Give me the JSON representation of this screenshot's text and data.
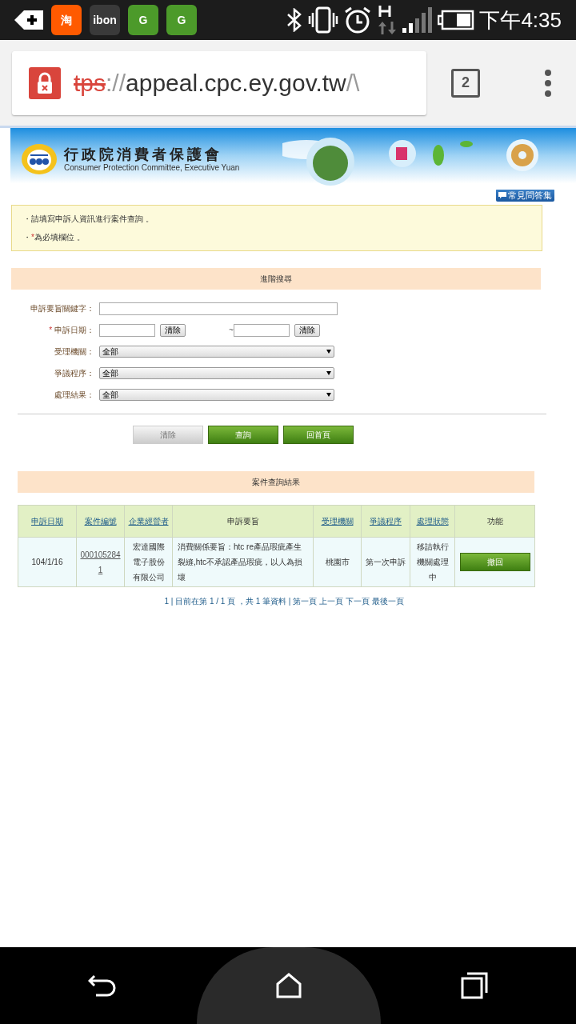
{
  "status_bar": {
    "apps": [
      {
        "label": "淘",
        "color": "#ff5a00"
      },
      {
        "label": "ibon",
        "color": "#3a3a3a"
      },
      {
        "label": "G",
        "color": "#4c9a2a"
      },
      {
        "label": "G",
        "color": "#4c9a2a"
      }
    ],
    "time": "下午4:35"
  },
  "browser": {
    "url": {
      "scheme": "tps",
      "separator": "://",
      "host": "appeal.cpc.ey.gov.tw",
      "rest": "/\\"
    },
    "tab_count": "2"
  },
  "banner": {
    "title": "行政院消費者保護會",
    "subtitle": "Consumer Protection Committee, Executive Yuan",
    "faq_button": "常見問答集"
  },
  "notice": [
    {
      "bullet": "・",
      "text": "請填寫申訴人資訊進行案件查詢 。"
    },
    {
      "bullet": "・",
      "required_mark": "*",
      "text": "為必填欄位 。"
    }
  ],
  "search": {
    "title": "進階搜尋",
    "fields": [
      {
        "kind": "text",
        "label": "申訴要旨關鍵字：",
        "required": false
      },
      {
        "kind": "date_range",
        "label": "申訴日期：",
        "required": true,
        "clear_label": "清除",
        "separator": "~",
        "clear_label_2": "清除"
      },
      {
        "kind": "select",
        "label": "受理機關：",
        "required": false,
        "value": "全部"
      },
      {
        "kind": "select",
        "label": "爭議程序：",
        "required": false,
        "value": "全部"
      },
      {
        "kind": "select",
        "label": "處理結果：",
        "required": false,
        "value": "全部"
      }
    ],
    "buttons": [
      {
        "label": "清除",
        "kind": "gray"
      },
      {
        "label": "查詢",
        "kind": "green"
      },
      {
        "label": "回首頁",
        "kind": "green"
      }
    ]
  },
  "results": {
    "title": "案件查詢結果",
    "columns": [
      {
        "label": "申訴日期",
        "link": true
      },
      {
        "label": "案件編號",
        "link": true
      },
      {
        "label": "企業經營者",
        "link": true
      },
      {
        "label": "申訴要旨",
        "link": false
      },
      {
        "label": "受理機關",
        "link": true
      },
      {
        "label": "爭議程序",
        "link": true
      },
      {
        "label": "處理狀態",
        "link": true
      },
      {
        "label": "功能",
        "link": false
      }
    ],
    "rows": [
      {
        "date": "104/1/16",
        "case_no": "0001052841",
        "company": "宏達國際電子股份有限公司",
        "summary": "消費關係要旨：htc re產品瑕疵產生裂縫,htc不承認產品瑕疵，以人為損壞",
        "agency": "桃園市",
        "procedure": "第一次申訴",
        "status": "移請執行機關處理中",
        "action": "撤回"
      }
    ],
    "pagination": "1 | 目前在第 1 / 1 頁 ，共 1 筆資料 | 第一頁 上一頁 下一頁 最後一頁"
  }
}
